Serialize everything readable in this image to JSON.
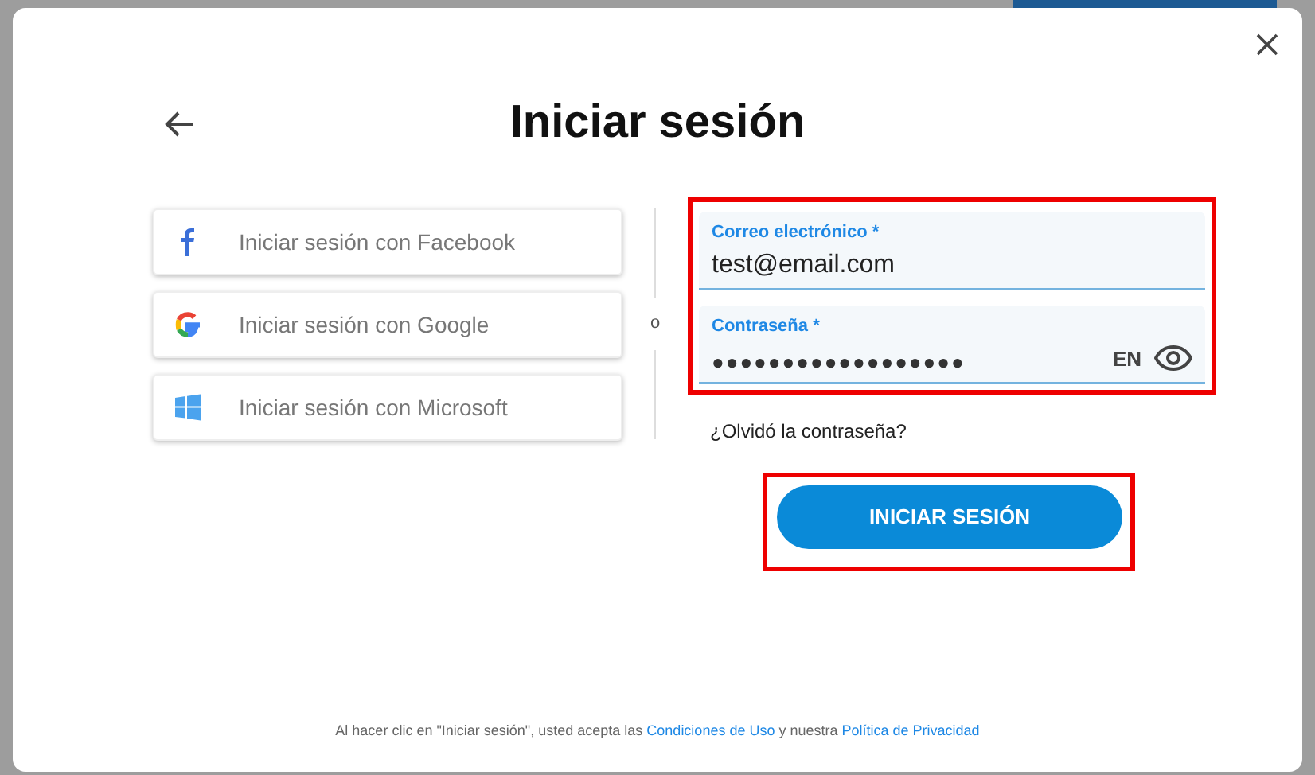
{
  "title": "Iniciar sesión",
  "social_buttons": [
    {
      "kind": "facebook",
      "label": "Iniciar sesión con Facebook"
    },
    {
      "kind": "google",
      "label": "Iniciar sesión con Google"
    },
    {
      "kind": "microsoft",
      "label": "Iniciar sesión con Microsoft"
    }
  ],
  "separator": "o",
  "credentials_highlighted": true,
  "email_field": {
    "label": "Correo electrónico *",
    "value": "test@email.com"
  },
  "password_field": {
    "label": "Contraseña *",
    "value": "●●●●●●●●●●●●●●●●●●",
    "language": "EN"
  },
  "forgot_link": "¿Olvidó la contraseña?",
  "submit_button": {
    "label": "INICIAR SESIÓN",
    "highlighted": true
  },
  "legal": [
    {
      "text": "Al hacer clic en \"Iniciar sesión\", usted acepta las ",
      "link": false
    },
    {
      "text": "Condiciones de Uso",
      "link": true
    },
    {
      "text": " y nuestra ",
      "link": false
    },
    {
      "text": "Política de Privacidad",
      "link": true
    }
  ]
}
